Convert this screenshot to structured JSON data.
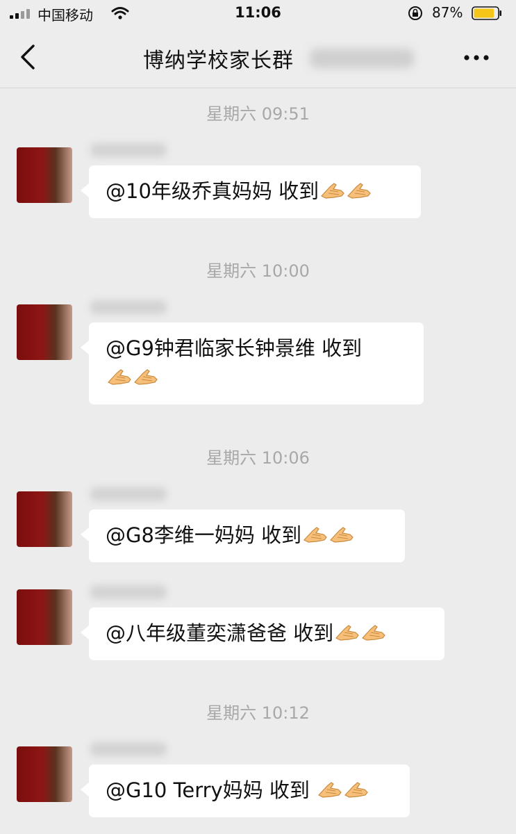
{
  "status_bar": {
    "carrier": "中国移动",
    "time": "11:06",
    "battery_percent": "87%",
    "battery_level": 0.87,
    "icons": [
      "signal-icon",
      "wifi-icon",
      "rotation-lock-icon",
      "battery-icon"
    ]
  },
  "nav": {
    "title": "博纳学校家长群",
    "back_icon": "chevron-left-icon",
    "more_icon": "more-icon"
  },
  "timestamps": [
    "星期六 09:51",
    "星期六 10:00",
    "星期六 10:06",
    "星期六 10:12"
  ],
  "messages": [
    {
      "text": "@10年级乔真妈妈 收到",
      "emoji": "ok-hand-icon",
      "emoji_count": 2
    },
    {
      "text": "@G9钟君临家长钟景维  收到",
      "emoji": "ok-hand-icon",
      "emoji_count": 2
    },
    {
      "text": "@G8李维一妈妈 收到",
      "emoji": "ok-hand-icon",
      "emoji_count": 2
    },
    {
      "text": "@八年级董奕潇爸爸 收到",
      "emoji": "ok-hand-icon",
      "emoji_count": 2
    },
    {
      "text": "@G10 Terry妈妈 收到 ",
      "emoji": "ok-hand-icon",
      "emoji_count": 2
    }
  ],
  "colors": {
    "background": "#ececec",
    "bubble": "#ffffff",
    "timestamp": "#a8a8a8",
    "battery": "#f5c518"
  }
}
